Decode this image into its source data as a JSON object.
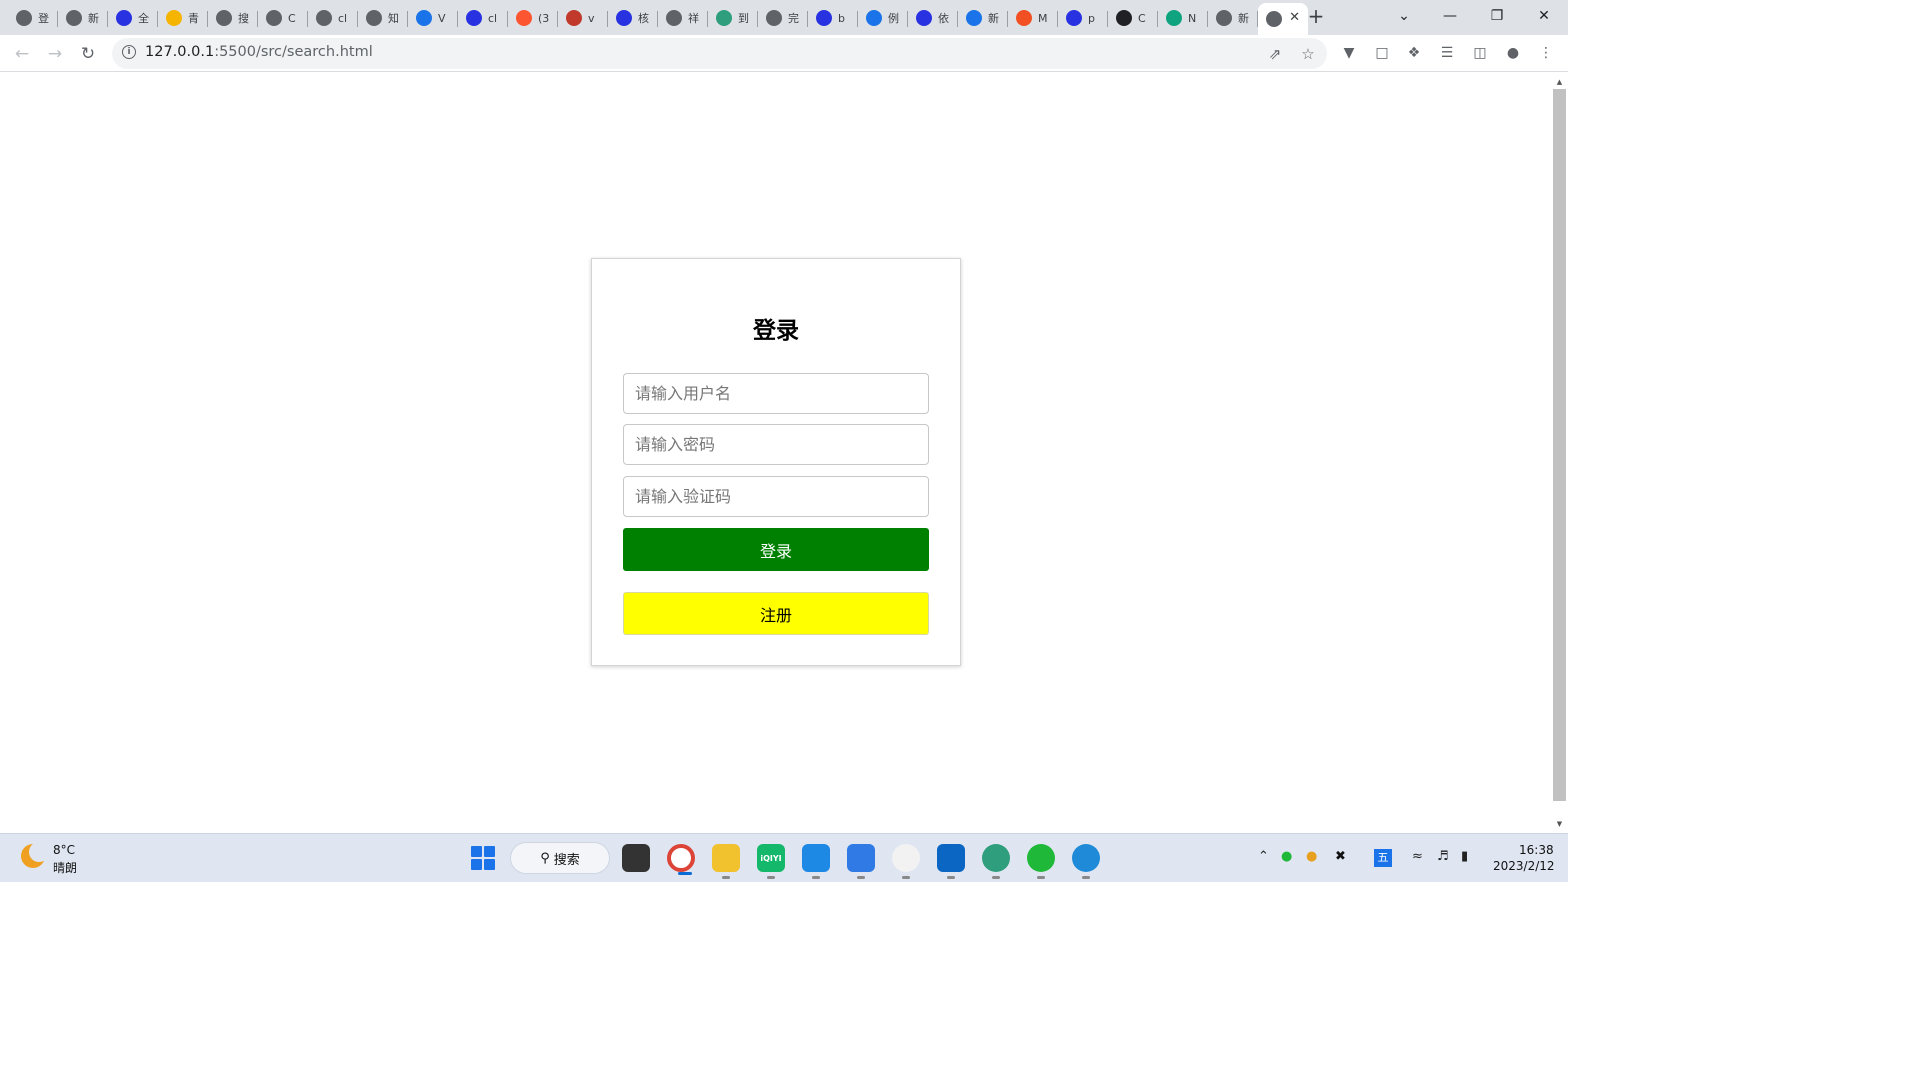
{
  "browser": {
    "tabs": [
      {
        "favicon": "generic-icon",
        "label": "登",
        "color": "#5f6368"
      },
      {
        "favicon": "globe-icon",
        "label": "新",
        "color": "#5f6368"
      },
      {
        "favicon": "baidu-paw-icon",
        "label": "全",
        "color": "#2932e1"
      },
      {
        "favicon": "star-icon",
        "label": "青",
        "color": "#f4b400"
      },
      {
        "favicon": "generic-icon",
        "label": "搜",
        "color": "#5f6368"
      },
      {
        "favicon": "generic-icon",
        "label": "C",
        "color": "#5f6368"
      },
      {
        "favicon": "generic-icon",
        "label": "cl",
        "color": "#5f6368"
      },
      {
        "favicon": "globe-icon",
        "label": "知",
        "color": "#5f6368"
      },
      {
        "favicon": "vscode-icon",
        "label": "V",
        "color": "#1a73e8"
      },
      {
        "favicon": "baidu-paw-icon",
        "label": "cl",
        "color": "#2932e1"
      },
      {
        "favicon": "csdn-icon",
        "label": "(3",
        "color": "#fc5531"
      },
      {
        "favicon": "b-icon",
        "label": "v",
        "color": "#c0392b"
      },
      {
        "favicon": "baidu-paw-icon",
        "label": "核",
        "color": "#2932e1"
      },
      {
        "favicon": "globe-icon",
        "label": "祥",
        "color": "#5f6368"
      },
      {
        "favicon": "earth-icon",
        "label": "到",
        "color": "#2e9e7c"
      },
      {
        "favicon": "generic-icon",
        "label": "完",
        "color": "#5f6368"
      },
      {
        "favicon": "baidu-paw-icon",
        "label": "b",
        "color": "#2932e1"
      },
      {
        "favicon": "kr-icon",
        "label": "例",
        "color": "#1a73e8"
      },
      {
        "favicon": "baidu-paw-icon",
        "label": "依",
        "color": "#2932e1"
      },
      {
        "favicon": "bing-icon",
        "label": "新",
        "color": "#1a73e8"
      },
      {
        "favicon": "microsoft-icon",
        "label": "M",
        "color": "#f25022"
      },
      {
        "favicon": "baidu-paw-icon",
        "label": "p",
        "color": "#2932e1"
      },
      {
        "favicon": "openai-icon",
        "label": "C",
        "color": "#202124"
      },
      {
        "favicon": "openai-icon",
        "label": "N",
        "color": "#10a37f"
      },
      {
        "favicon": "globe-icon",
        "label": "新",
        "color": "#5f6368"
      },
      {
        "favicon": "generic-icon",
        "label": "",
        "color": "#5f6368",
        "active": true
      }
    ],
    "url": {
      "host": "127.0.0.1",
      "path": ":5500/src/search.html"
    }
  },
  "page": {
    "title": "登录",
    "username_placeholder": "请输入用户名",
    "password_placeholder": "请输入密码",
    "captcha_placeholder": "请输入验证码",
    "login_label": "登录",
    "register_label": "注册"
  },
  "taskbar": {
    "weather_temp": "8°C",
    "weather_desc": "晴朗",
    "search_label": "搜索",
    "ime_label": "五",
    "time": "16:38",
    "date": "2023/2/12"
  },
  "colors": {
    "login_button": "#008000",
    "register_button": "#ffff00"
  }
}
